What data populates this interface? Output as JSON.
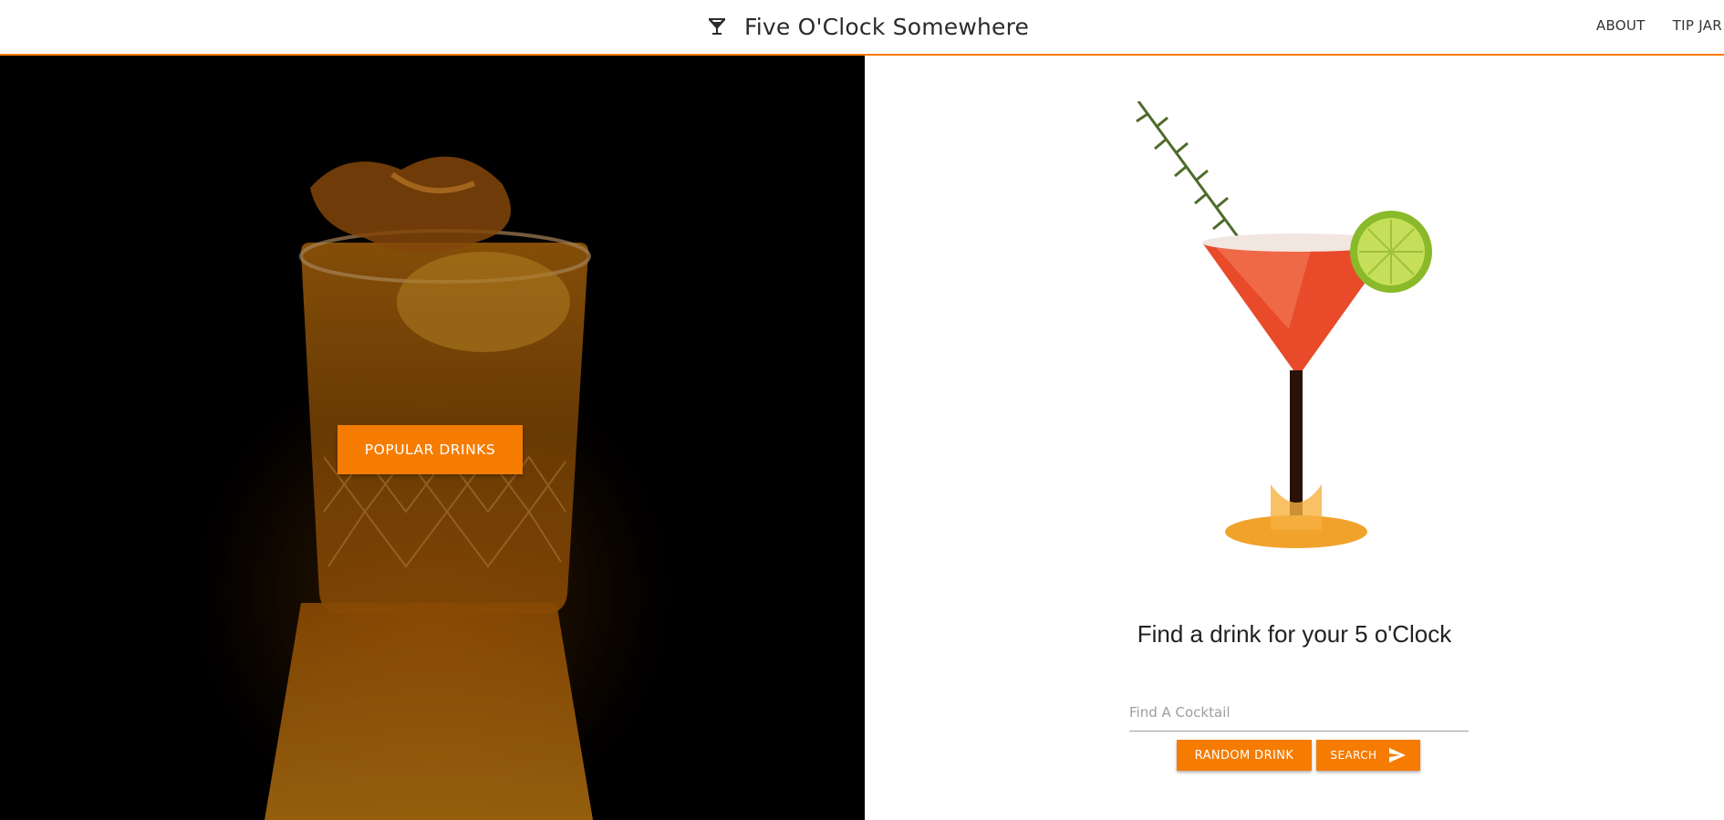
{
  "header": {
    "brand_icon": "cocktail-glass-icon",
    "title": "Five O'Clock Somewhere",
    "nav": [
      {
        "label": "ABOUT"
      },
      {
        "label": "TIP JAR"
      }
    ]
  },
  "hero": {
    "image": "whiskey-glass-with-orange-peel-photo",
    "button_label": "POPULAR DRINKS"
  },
  "panel": {
    "image": "red-martini-cocktail-with-lime-and-rosemary",
    "tagline": "Find a drink for your 5 o'Clock",
    "search": {
      "placeholder": "Find A Cocktail",
      "value": ""
    },
    "random_button_label": "RANDOM DRINK",
    "search_button_label": "SEARCH",
    "search_button_icon": "send-icon"
  },
  "colors": {
    "accent": "#f57c00",
    "header_bg": "#ffffff",
    "hero_bg": "#000000"
  }
}
